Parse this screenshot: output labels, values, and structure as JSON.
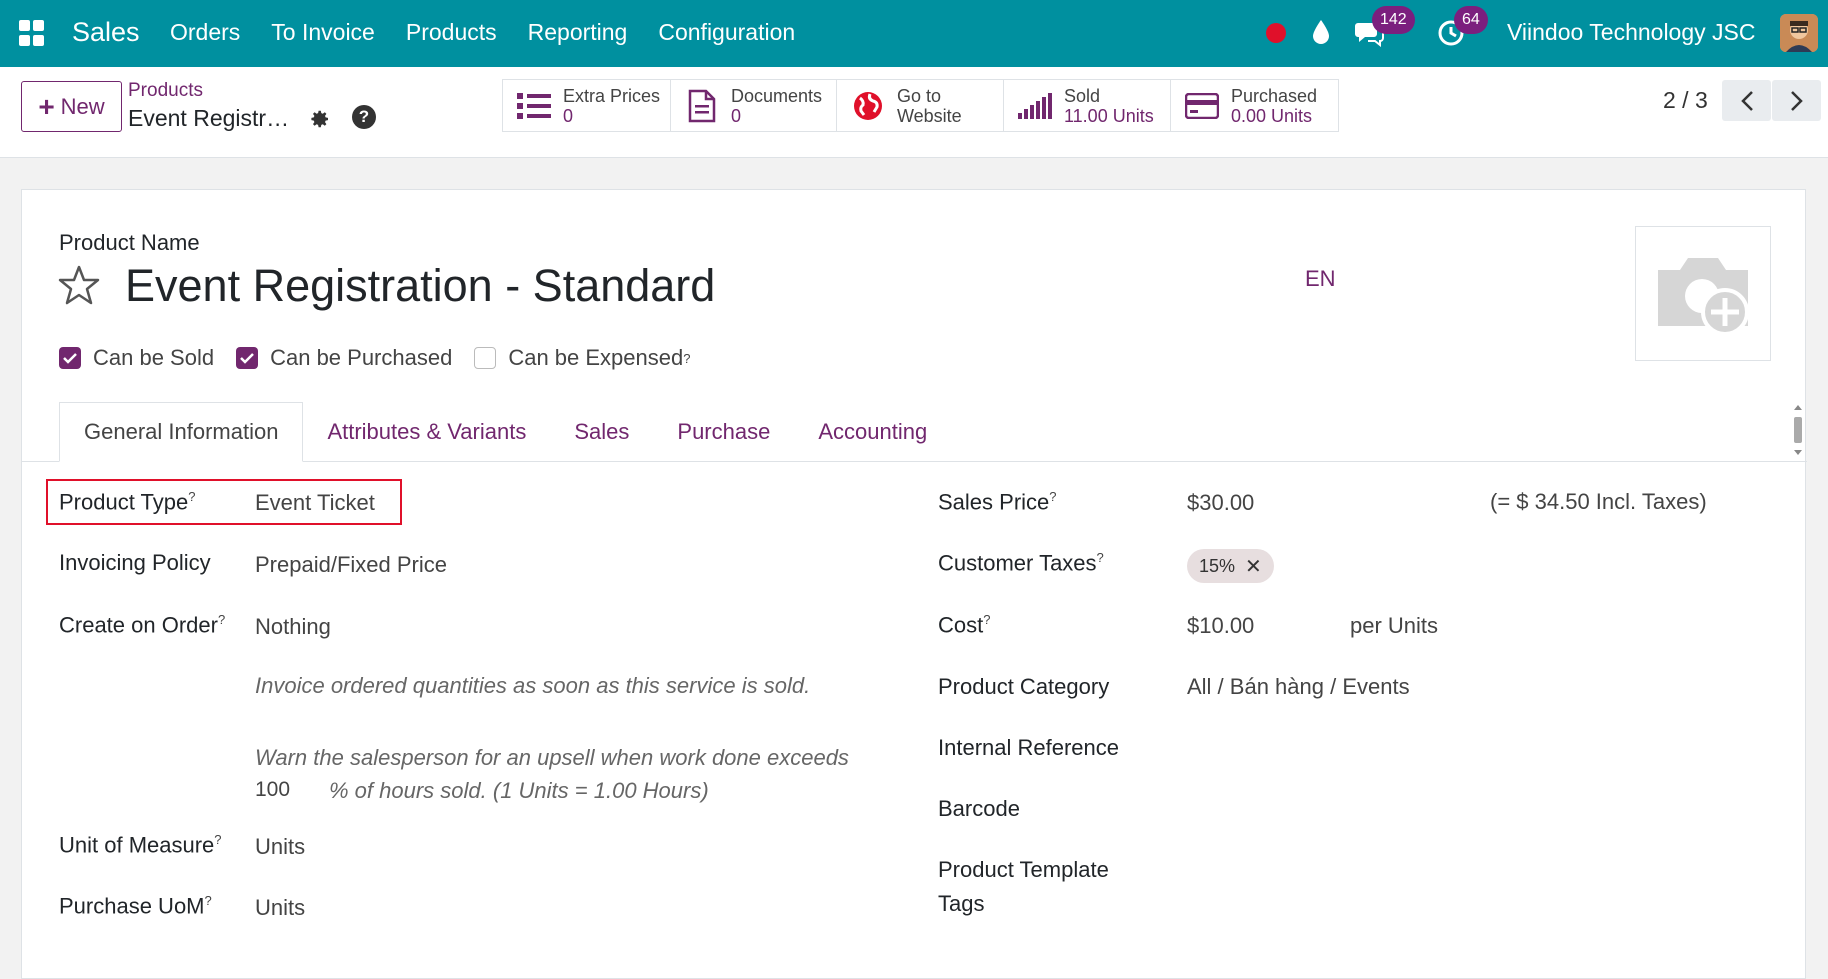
{
  "topbar": {
    "brand": "Sales",
    "nav": [
      "Orders",
      "To Invoice",
      "Products",
      "Reporting",
      "Configuration"
    ],
    "messages_count": "142",
    "activities_count": "64",
    "company": "Viindoo Technology JSC"
  },
  "control_panel": {
    "new_label": "New",
    "breadcrumb_parent": "Products",
    "breadcrumb_current": "Event Registration - Standard",
    "smart_buttons": {
      "extra_prices": {
        "label": "Extra Prices",
        "value": "0"
      },
      "documents": {
        "label": "Documents",
        "value": "0"
      },
      "website": {
        "label_line1": "Go to",
        "label_line2": "Website"
      },
      "sold": {
        "label": "Sold",
        "value": "11.00 Units"
      },
      "purchased": {
        "label": "Purchased",
        "value": "0.00 Units"
      }
    },
    "pager": "2 / 3"
  },
  "form": {
    "name_label": "Product Name",
    "name": "Event Registration - Standard",
    "lang": "EN",
    "checks": {
      "can_be_sold": {
        "label": "Can be Sold",
        "checked": true
      },
      "can_be_purchased": {
        "label": "Can be Purchased",
        "checked": true
      },
      "can_be_expensed": {
        "label": "Can be Expensed",
        "checked": false
      }
    },
    "tabs": [
      "General Information",
      "Attributes & Variants",
      "Sales",
      "Purchase",
      "Accounting"
    ],
    "left": {
      "product_type": {
        "label": "Product Type",
        "value": "Event Ticket"
      },
      "invoicing_policy": {
        "label": "Invoicing Policy",
        "value": "Prepaid/Fixed Price"
      },
      "create_on_order": {
        "label": "Create on Order",
        "value": "Nothing"
      },
      "hint1": "Invoice ordered quantities as soon as this service is sold.",
      "hint2_line1": "Warn the salesperson for an upsell when work done exceeds",
      "hint2_value": "100",
      "hint2_line2": "% of hours sold. (1 Units = 1.00 Hours)",
      "uom": {
        "label": "Unit of Measure",
        "value": "Units"
      },
      "purchase_uom": {
        "label": "Purchase UoM",
        "value": "Units"
      }
    },
    "right": {
      "sales_price": {
        "label": "Sales Price",
        "value": "$30.00",
        "incl": "(= $ 34.50 Incl. Taxes)"
      },
      "customer_taxes": {
        "label": "Customer Taxes",
        "tag": "15%"
      },
      "cost": {
        "label": "Cost",
        "value": "$10.00",
        "unit": "per Units"
      },
      "category": {
        "label": "Product Category",
        "value": "All / Bán hàng / Events"
      },
      "internal_ref": {
        "label": "Internal Reference"
      },
      "barcode": {
        "label": "Barcode"
      },
      "template_tags": {
        "label_line1": "Product Template",
        "label_line2": "Tags"
      }
    }
  },
  "colors": {
    "topbar": "#00909f",
    "accent": "#71276e",
    "highlight": "#e0102a"
  }
}
